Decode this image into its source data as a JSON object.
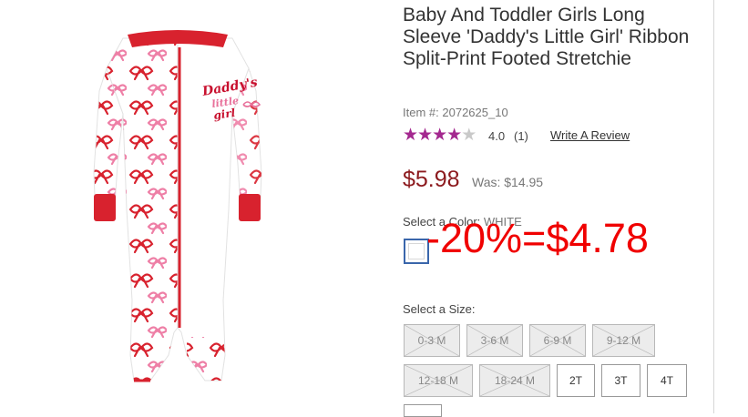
{
  "product": {
    "title": "Baby And Toddler Girls Long Sleeve 'Daddy's Little Girl' Ribbon Split-Print Footed Stretchie",
    "item_label": "Item #:",
    "item_number": "2072625_10",
    "rating": {
      "stars": 4,
      "max": 5,
      "value": "4.0",
      "count": "(1)",
      "review_link": "Write A Review"
    },
    "price": "$5.98",
    "was_price": "Was: $14.95",
    "color": {
      "label": "Select a Color:",
      "selected": "WHITE",
      "swatch_color": "#ffffff"
    },
    "size_label": "Select a Size:",
    "sizes": [
      {
        "label": "0-3 M",
        "available": false
      },
      {
        "label": "3-6 M",
        "available": false
      },
      {
        "label": "6-9 M",
        "available": false
      },
      {
        "label": "9-12 M",
        "available": false
      },
      {
        "label": "12-18 M",
        "available": false
      },
      {
        "label": "18-24 M",
        "available": false
      },
      {
        "label": "2T",
        "available": true
      },
      {
        "label": "3T",
        "available": true
      },
      {
        "label": "4T",
        "available": true
      }
    ],
    "image_text": {
      "line1": "Daddy's",
      "line2": "little",
      "line3": "girl"
    }
  },
  "annotation": {
    "text": "-20%=$4.78",
    "color": "#f00000"
  },
  "colors": {
    "price_red": "#8c1a1e",
    "star_purple": "#a4288f",
    "pajama_red": "#d8222e",
    "ribbon_pink": "#e8709a"
  }
}
